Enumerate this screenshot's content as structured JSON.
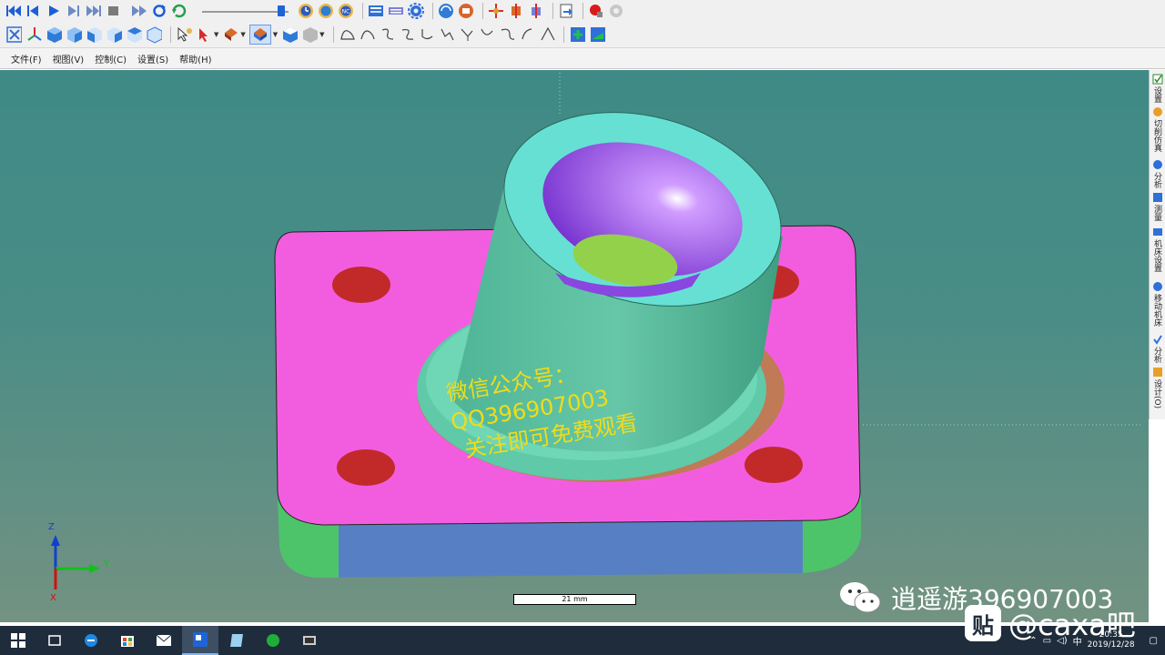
{
  "toolbar_top": {
    "icons": [
      "go-start-icon",
      "step-back-icon",
      "play-icon",
      "step-forward-icon",
      "go-end-icon",
      "stop-icon",
      "fast-forward-icon",
      "loop-icon",
      "refresh-icon"
    ],
    "slider_level": 0.95,
    "right_icons": [
      "clock-icon",
      "globe-icon",
      "nc-icon",
      "view-window-icon",
      "keyboard-icon",
      "gear-icon",
      "cube-rotate-icon",
      "tool-icon",
      "axis-move-icon",
      "axis-rotate-icon",
      "axis-3d-icon",
      "export-icon",
      "record-icon",
      "hand-icon"
    ]
  },
  "toolbar_second": {
    "icons": [
      "fit-icon",
      "iso-view-icon",
      "front-view-icon",
      "back-view-icon",
      "left-view-icon",
      "right-view-icon",
      "top-view-icon",
      "bottom-view-icon",
      "select-icon",
      "pointer-icon",
      "paint-icon",
      "shading-icon",
      "box-icon",
      "section-icon",
      "curve-1-icon",
      "curve-2-icon",
      "curve-3-icon",
      "curve-4-icon",
      "curve-5-icon",
      "curve-6-icon",
      "curve-7-icon",
      "curve-8-icon",
      "curve-9-icon",
      "curve-10-icon",
      "curve-11-icon",
      "add-icon",
      "save-icon"
    ]
  },
  "menubar": {
    "items": [
      "文件(F)",
      "视图(V)",
      "控制(C)",
      "设置(S)",
      "帮助(H)"
    ]
  },
  "viewport": {
    "axes": {
      "z": "Z",
      "y": "Y",
      "x": "X"
    },
    "scale_label": "21 mm",
    "watermark": {
      "line1": "微信公众号：",
      "line2": "QQ396907003",
      "line3": "关注即可免费观看"
    },
    "colors": {
      "base_top": "#f25de0",
      "boss": "#5fc9a8",
      "rim": "#67e0d4",
      "bore": "#a35af0",
      "bore_floor": "#93d14a",
      "holes": "#c22a2a",
      "base_side": "#5780c4",
      "base_corners": "#4ec46a",
      "washer": "#c07a55",
      "axis_z": "#1040d0",
      "axis_y": "#12c01a",
      "axis_x": "#d01010"
    }
  },
  "right_panel": {
    "tabs": [
      "设置",
      "切削仿真",
      "分析",
      "测量",
      "机床设置",
      "移动机床",
      "分析",
      "设计(O)"
    ]
  },
  "taskbar": {
    "icons": [
      "windows-start-icon",
      "task-view-icon",
      "edge-icon",
      "store-icon",
      "mail-icon",
      "vericut-app-icon",
      "paper-icon",
      "green-app-icon",
      "media-app-icon"
    ],
    "tray_lang": "中",
    "time": "20:35",
    "date": "2019/12/28"
  },
  "brand": {
    "wechat_text": "逍遥游396907003",
    "tieba_glyph": "贴",
    "tieba_text": "@caxa吧"
  }
}
